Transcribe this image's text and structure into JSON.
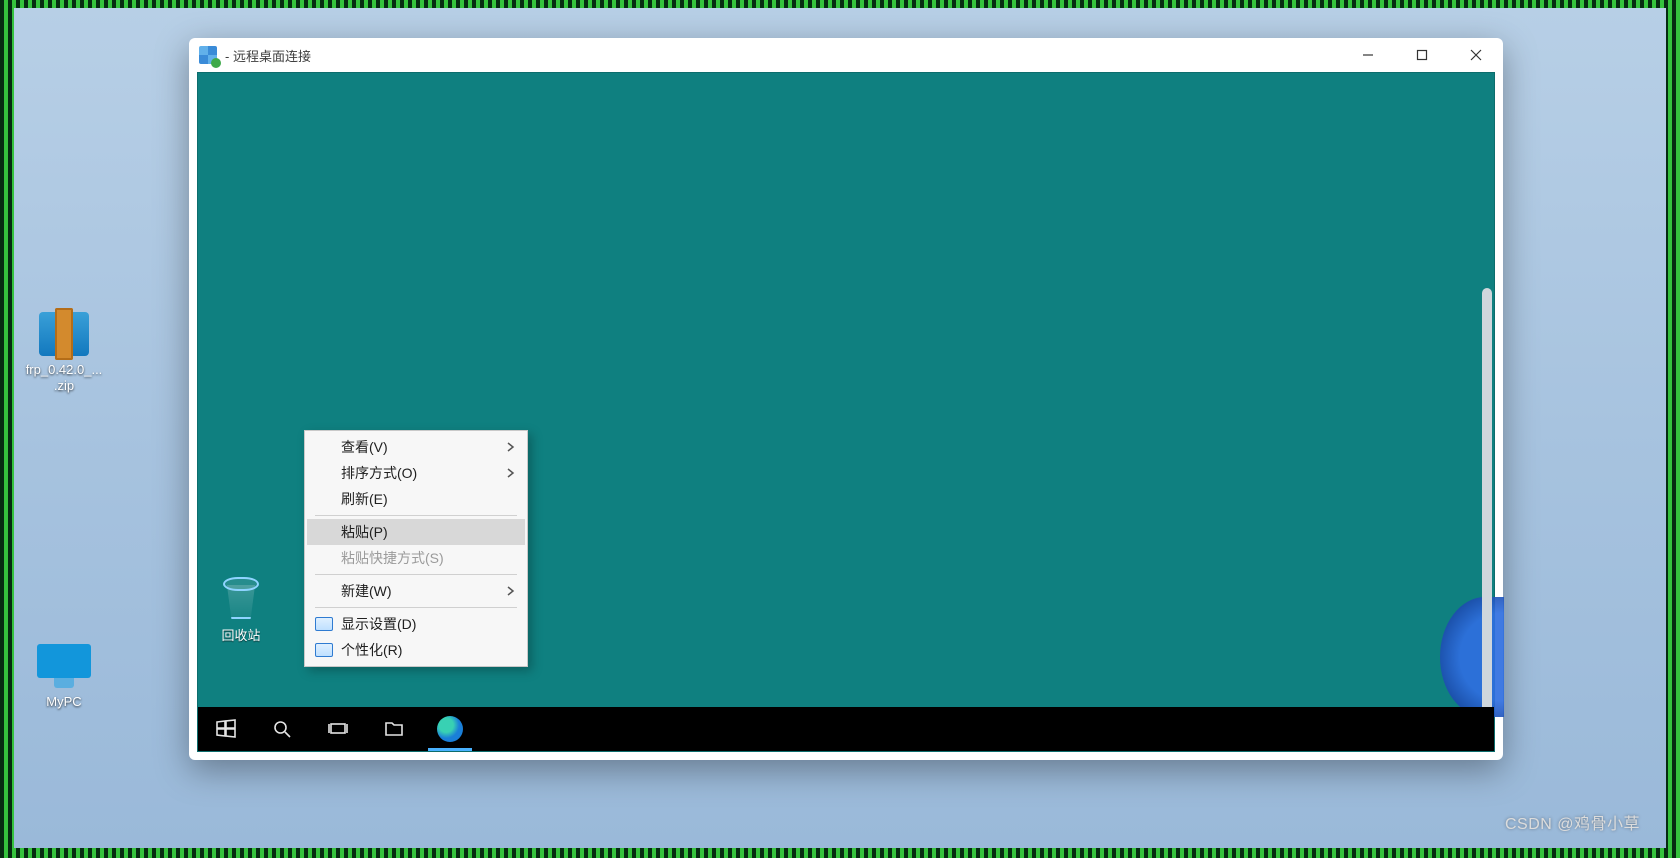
{
  "rdp_window": {
    "title_prefix": "       ",
    "title_suffix": " - 远程桌面连接"
  },
  "local_desktop": {
    "icons": {
      "zip": {
        "line1": "frp_0.42.0_...",
        "line2": ".zip"
      },
      "mypc": {
        "label": "MyPC"
      }
    }
  },
  "remote": {
    "recycle_bin_label": "回收站",
    "context_menu": {
      "view": "查看(V)",
      "sort_by": "排序方式(O)",
      "refresh": "刷新(E)",
      "paste": "粘贴(P)",
      "paste_shortcut": "粘贴快捷方式(S)",
      "new": "新建(W)",
      "display_settings": "显示设置(D)",
      "personalize": "个性化(R)"
    }
  },
  "watermark": "CSDN @鸡骨小草"
}
